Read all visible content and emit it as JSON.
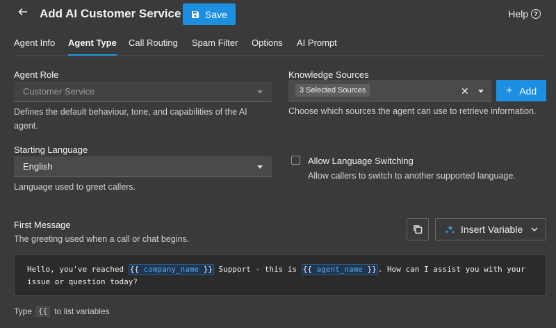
{
  "header": {
    "title": "Add AI Customer Service",
    "save_label": "Save",
    "help_label": "Help",
    "accent_color": "#1d8fe1"
  },
  "tabs": [
    {
      "label": "Agent Info",
      "active": false
    },
    {
      "label": "Agent Type",
      "active": true
    },
    {
      "label": "Call Routing",
      "active": false
    },
    {
      "label": "Spam Filter",
      "active": false
    },
    {
      "label": "Options",
      "active": false
    },
    {
      "label": "AI Prompt",
      "active": false
    }
  ],
  "agent_role": {
    "label": "Agent Role",
    "placeholder": "Customer Service",
    "help": "Defines the default behaviour, tone, and capabilities of the AI agent."
  },
  "knowledge_sources": {
    "label": "Knowledge Sources",
    "selected": "3 Selected Sources",
    "add_label": "Add",
    "help": "Choose which sources the agent can use to retrieve information."
  },
  "starting_language": {
    "label": "Starting Language",
    "value": "English",
    "help": "Language used to greet callers."
  },
  "language_switching": {
    "label": "Allow Language Switching",
    "checked": false,
    "help": "Allow callers to switch to another supported language."
  },
  "first_message": {
    "label": "First Message",
    "help": "The greeting used when a call or chat begins.",
    "insert_variable_label": "Insert Variable",
    "text_part1": "Hello, you've reached ",
    "var1": "company_name",
    "text_part2": " Support - this is ",
    "var2": "agent_name",
    "text_part3": ". How can I assist you with your issue or question today?",
    "brace_open": "{{",
    "brace_close": "}}"
  },
  "footer": {
    "hint_prefix": "Type",
    "hint_code": "{{",
    "hint_suffix": "to list variables"
  },
  "icons": [
    "back-arrow-icon",
    "save-disk-icon",
    "help-circle-icon",
    "chevron-down-icon",
    "clear-x-icon",
    "plus-icon",
    "copy-icon",
    "sparkle-icon"
  ]
}
